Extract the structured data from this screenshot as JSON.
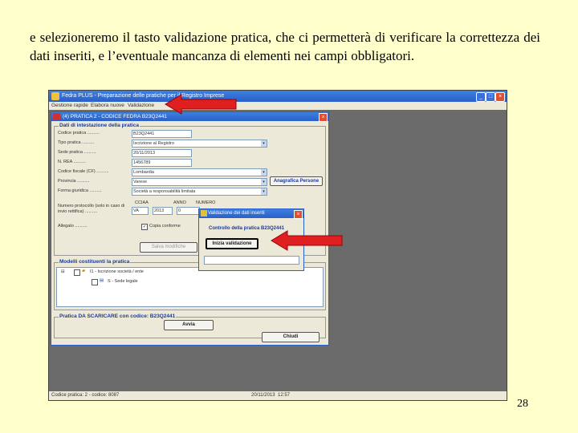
{
  "slide": {
    "paragraph": "e selezioneremo il tasto validazione pratica, che ci permetterà di verificare la correttezza dei dati inseriti, e l’eventuale mancanza di elementi nei campi obbligatori.",
    "page_number": "28"
  },
  "app": {
    "title": "Fedra PLUS - Preparazione delle pratiche per il Registro Imprese",
    "menu": [
      "Gestione rapide",
      "Elabora nuove",
      "Validazione"
    ],
    "status_left": "Codice pratica: 2 - codice: 8087",
    "status_date": "20/11/2013",
    "status_time": "12:57"
  },
  "dialog": {
    "title": "(4) PRATICA 2 - CODICE FEDRA B23Q2441",
    "group_header": "Dati di intestazione della pratica",
    "fields": [
      {
        "label": "Codice pratica ..........",
        "value": "B23Q2441"
      },
      {
        "label": "Tipo pratica ..........",
        "value": "Iscrizione al Registro"
      },
      {
        "label": "Sede pratica ..........",
        "value": "20/11/2013"
      },
      {
        "label": "N. REA ..........",
        "value": "1456789"
      },
      {
        "label": "Codice fiscale (CF) ..........",
        "value": "Lombardia"
      },
      {
        "label": "Provincia ..........",
        "value": "Varese"
      },
      {
        "label": "Forma giuridica ..........",
        "value": "Società a responsabilità limitata"
      }
    ],
    "anagrafica_button": "Anagrafica Persone",
    "protocol_label": "Numero protocollo (solo in caso di invio rettifica) ..........",
    "protocol_cols": [
      "CCIAA",
      "ANNO",
      "NUMERO"
    ],
    "protocol_values": [
      "VA",
      "2013",
      "0"
    ],
    "allegato_label": "Allegato ..........",
    "copy_checkbox_label": "Copia conforme",
    "save_button": "Salva modifiche",
    "models_header": "Modelli costituenti la pratica",
    "tree_items": [
      "I1 - Iscrizione società / ente",
      "S - Sede legale"
    ],
    "discharge_header": "Pratica DA SCARICARE con codice: B23Q2441",
    "discharge_button": "Avvia",
    "close_button": "Chiudi"
  },
  "validation": {
    "title": "Validazione dei dati inseriti",
    "subtitle": "Controllo della pratica B23Q2441",
    "button": "Inizia validazione"
  },
  "colors": {
    "slide_background": "#ffffcc",
    "arrow": "#e02020",
    "titlebar": "#2a5fc8"
  }
}
